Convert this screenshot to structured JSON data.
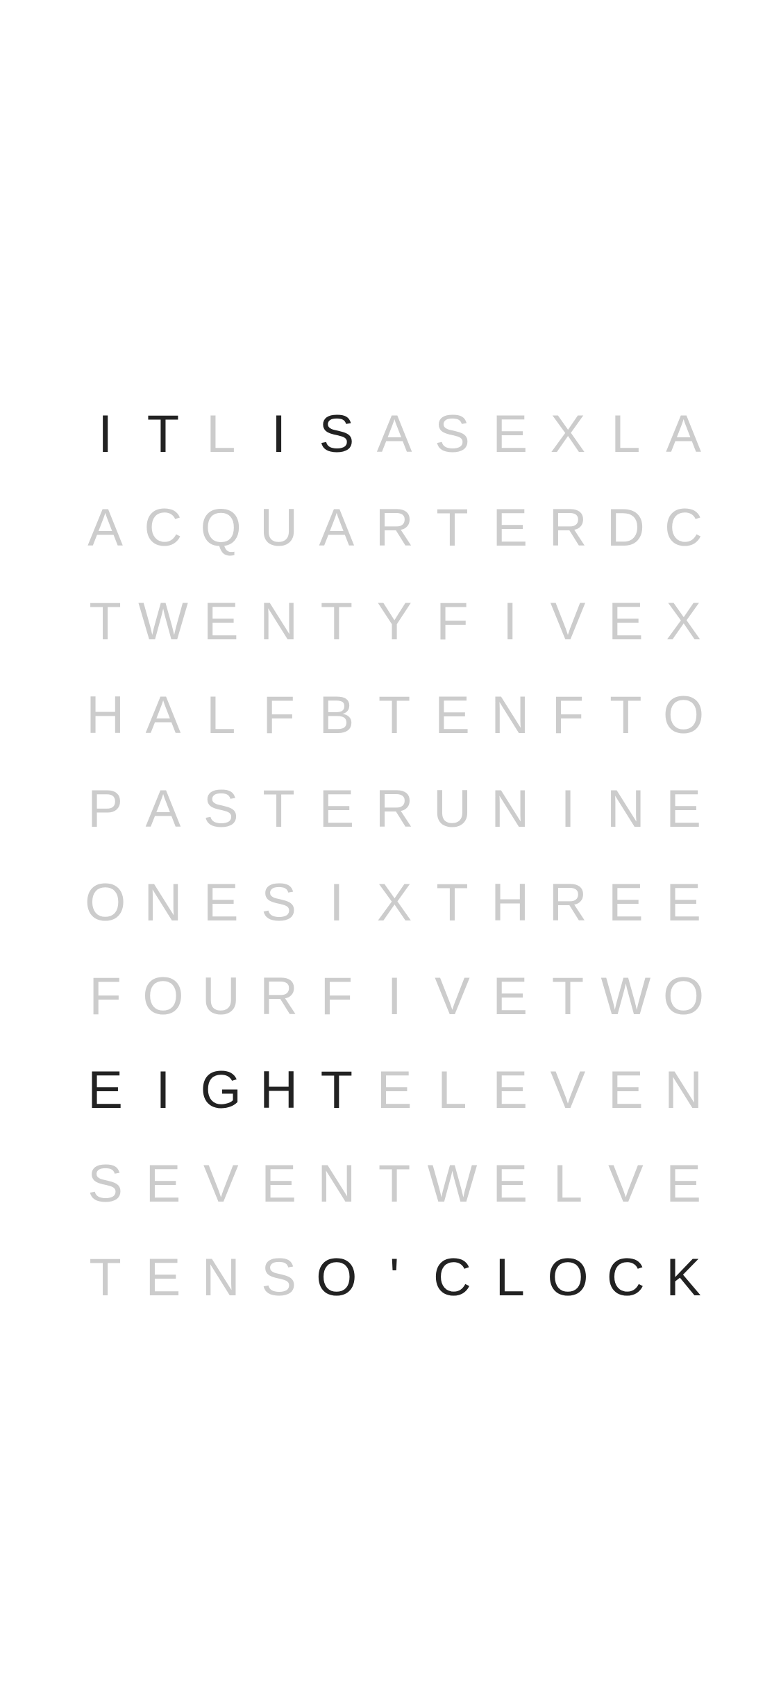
{
  "clock": {
    "rows": [
      [
        "I",
        "T",
        "L",
        "I",
        "S",
        "A",
        "S",
        "E",
        "X",
        "L",
        "A"
      ],
      [
        "A",
        "C",
        "Q",
        "U",
        "A",
        "R",
        "T",
        "E",
        "R",
        "D",
        "C"
      ],
      [
        "T",
        "W",
        "E",
        "N",
        "T",
        "Y",
        "F",
        "I",
        "V",
        "E",
        "X"
      ],
      [
        "H",
        "A",
        "L",
        "F",
        "B",
        "T",
        "E",
        "N",
        "F",
        "T",
        "O"
      ],
      [
        "P",
        "A",
        "S",
        "T",
        "E",
        "R",
        "U",
        "N",
        "I",
        "N",
        "E"
      ],
      [
        "O",
        "N",
        "E",
        "S",
        "I",
        "X",
        "T",
        "H",
        "R",
        "E",
        "E"
      ],
      [
        "F",
        "O",
        "U",
        "R",
        "F",
        "I",
        "V",
        "E",
        "T",
        "W",
        "O"
      ],
      [
        "E",
        "I",
        "G",
        "H",
        "T",
        "E",
        "L",
        "E",
        "V",
        "E",
        "N"
      ],
      [
        "S",
        "E",
        "V",
        "E",
        "N",
        "T",
        "W",
        "E",
        "L",
        "V",
        "E"
      ],
      [
        "T",
        "E",
        "N",
        "S",
        "O",
        "'",
        "C",
        "L",
        "O",
        "C",
        "K"
      ]
    ],
    "lit": [
      [
        0,
        0
      ],
      [
        0,
        1
      ],
      [
        0,
        3
      ],
      [
        0,
        4
      ],
      [
        7,
        0
      ],
      [
        7,
        1
      ],
      [
        7,
        2
      ],
      [
        7,
        3
      ],
      [
        7,
        4
      ],
      [
        9,
        4
      ],
      [
        9,
        5
      ],
      [
        9,
        6
      ],
      [
        9,
        7
      ],
      [
        9,
        8
      ],
      [
        9,
        9
      ],
      [
        9,
        10
      ]
    ],
    "colors": {
      "lit": "#222222",
      "unlit": "#cccccc",
      "background": "#ffffff"
    }
  }
}
